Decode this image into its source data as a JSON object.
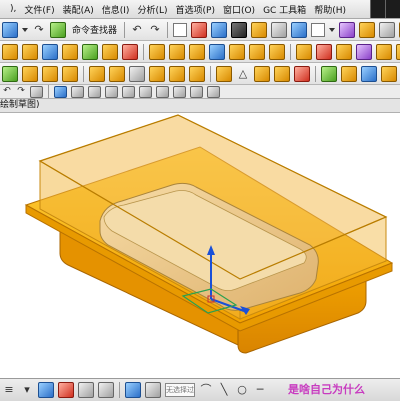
{
  "menu": {
    "items": [
      "文件(F)",
      "装配(A)",
      "信息(I)",
      "分析(L)",
      "首选项(P)",
      "窗口(O)",
      "GC 工具箱",
      "帮助(H)"
    ],
    "partial_first": "),"
  },
  "toolbar1": {
    "command_finder_label": "命令查找器"
  },
  "sketch_bar": {
    "title": "绘制草图)"
  },
  "status": {
    "field_text": "无选择过滤"
  },
  "watermark": {
    "text": "是啥自己为什么 "
  },
  "colors": {
    "accent": "#2b6fc9",
    "model_orange": "#f5a000",
    "transparent_body": "#f2b53c",
    "inner_part": "#ecca8a"
  },
  "icons": {
    "toolbar1": [
      "fill-icon",
      "curve-icon",
      "command-finder-icon",
      "cube-icon",
      "blue-dialog-icon",
      "green-check-icon",
      "sphere-icon",
      "shaded-cube-icon",
      "yinyang-icon",
      "arrow-icon",
      "layer-icon",
      "color-icon",
      "box-icon",
      "view-icon",
      "cube-icon",
      "cube-icon",
      "cube-icon",
      "settings-icon",
      "cube-icon",
      "arrow-icon"
    ],
    "toolbar2": [
      "cube-icon",
      "cube-icon",
      "cube-icon",
      "cube-icon",
      "cube-icon",
      "cube-icon",
      "cube-icon",
      "cube-icon",
      "cube-icon",
      "cube-icon",
      "cube-icon",
      "cube-icon",
      "cube-icon",
      "cube-icon",
      "cube-icon",
      "cube-icon",
      "cube-icon",
      "cube-icon",
      "cube-icon",
      "cube-icon"
    ],
    "toolbar3": [
      "cube-icon",
      "cylinder-icon",
      "cube-icon",
      "cube-icon",
      "cube-icon",
      "cube-icon",
      "cube-icon",
      "cube-icon",
      "cube-icon",
      "cube-icon",
      "cube-icon",
      "cube-icon",
      "triangle-icon",
      "cube-icon",
      "cube-icon",
      "cube-icon",
      "check-icon",
      "cube-icon",
      "cube-icon",
      "cube-icon"
    ]
  }
}
